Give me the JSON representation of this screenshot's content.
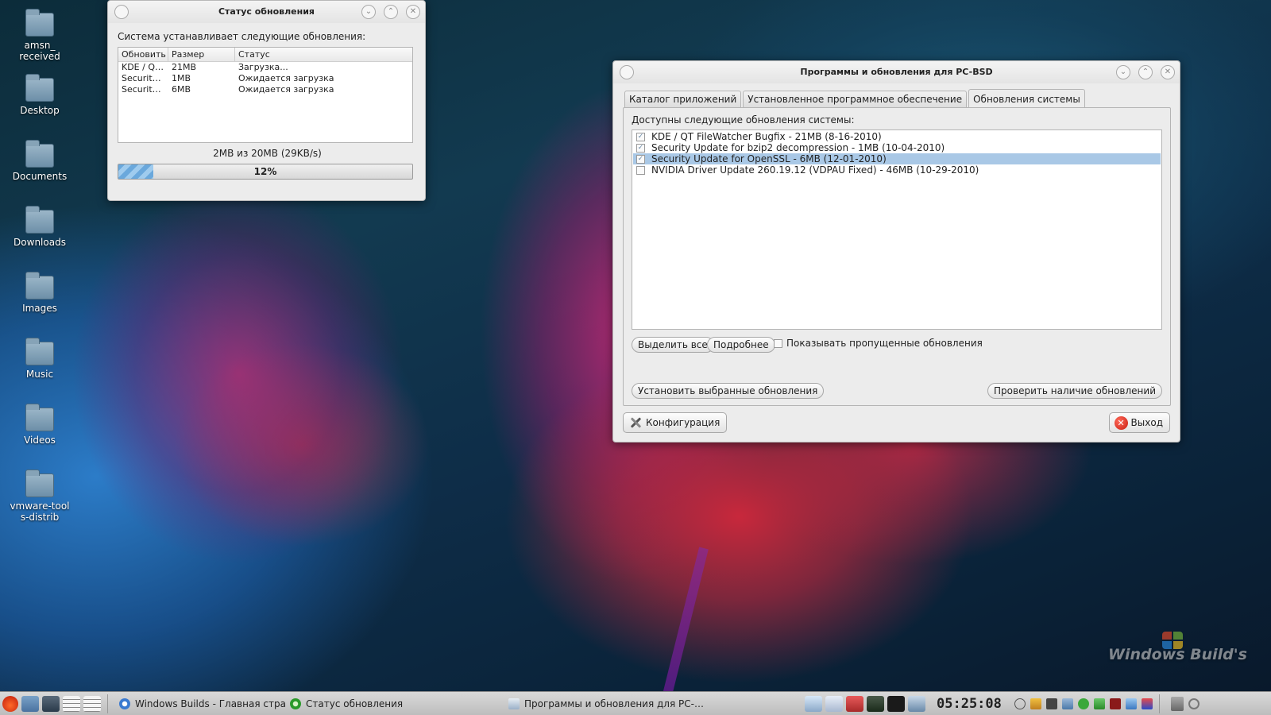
{
  "desktop": {
    "icons": [
      {
        "label": "amsn_ received"
      },
      {
        "label": "Desktop"
      },
      {
        "label": "Documents"
      },
      {
        "label": "Downloads"
      },
      {
        "label": "Images"
      },
      {
        "label": "Music"
      },
      {
        "label": "Videos"
      },
      {
        "label": "vmware-tools-distrib"
      }
    ],
    "watermark": "Windows Build's"
  },
  "status_window": {
    "title": "Статус обновления",
    "intro": "Система устанавливает следующие обновления:",
    "columns": [
      "Обновить",
      "Размер",
      "Статус"
    ],
    "rows": [
      {
        "name": "KDE / Q…",
        "size": "21MB",
        "status": "Загрузка..."
      },
      {
        "name": "Securit…",
        "size": "1MB",
        "status": "Ожидается загрузка"
      },
      {
        "name": "Securit…",
        "size": "6MB",
        "status": "Ожидается загрузка"
      }
    ],
    "progress_text": "2MB из 20MB (29KB/s)",
    "progress_label": "12%",
    "progress_fraction": 0.12
  },
  "updates_window": {
    "title": "Программы и обновления для PC-BSD",
    "tabs": [
      {
        "label": "Каталог приложений",
        "active": false
      },
      {
        "label": "Установленное программное обеспечение",
        "active": false
      },
      {
        "label": "Обновления системы",
        "active": true
      }
    ],
    "available_label": "Доступны следующие обновления системы:",
    "updates": [
      {
        "label": "KDE / QT FileWatcher Bugfix - 21MB (8-16-2010)",
        "checked": true,
        "selected": false
      },
      {
        "label": "Security Update for bzip2 decompression - 1MB (10-04-2010)",
        "checked": true,
        "selected": false
      },
      {
        "label": "Security Update for OpenSSL - 6MB (12-01-2010)",
        "checked": true,
        "selected": true
      },
      {
        "label": "NVIDIA Driver Update 260.19.12 (VDPAU Fixed) - 46MB (10-29-2010)",
        "checked": false,
        "selected": false
      }
    ],
    "select_all": "Выделить все",
    "details": "Подробнее",
    "show_skipped": "Показывать пропущенные обновления",
    "install_selected": "Установить выбранные обновления",
    "check_updates": "Проверить наличие обновлений",
    "config": "Конфигурация",
    "exit": "Выход"
  },
  "taskbar": {
    "tasks": [
      {
        "label": "Windows Builds - Главная страни…",
        "icon": "browser-icon"
      },
      {
        "label": "Статус обновления",
        "icon": "update-icon"
      },
      {
        "label": "Программы и обновления для PC-…",
        "icon": "window-icon"
      }
    ],
    "clock": "05:25:08"
  },
  "colors": {
    "selection": "#a9c8e6",
    "progress": "#6aa8dc",
    "exit_icon": "#c81c10"
  }
}
